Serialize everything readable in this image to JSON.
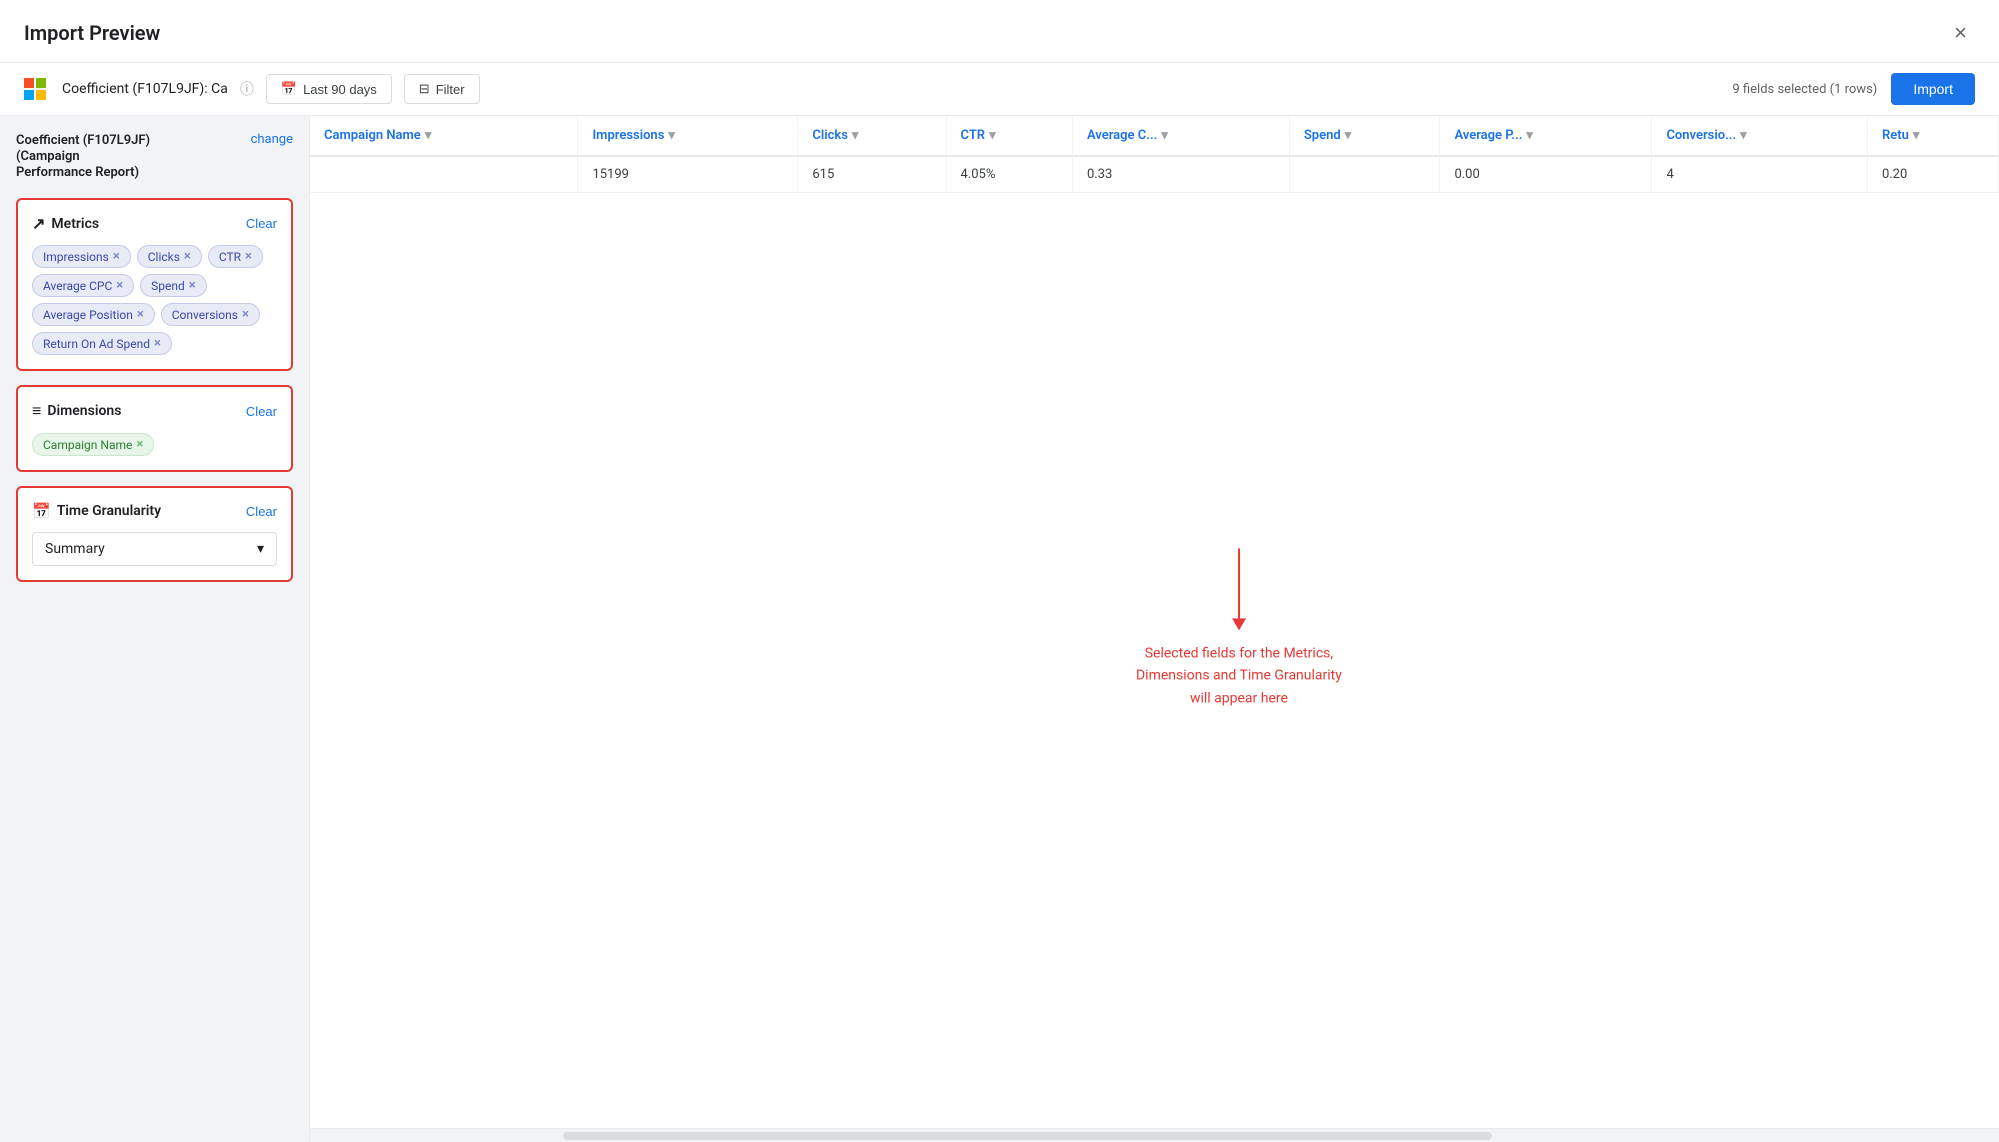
{
  "modal": {
    "title": "Import Preview",
    "close_label": "×"
  },
  "toolbar": {
    "source_name": "Coefficient (F107L9JF): Ca",
    "date_btn_label": "Last 90 days",
    "filter_btn_label": "Filter",
    "fields_info": "9 fields selected (1 rows)",
    "import_label": "Import"
  },
  "sidebar": {
    "source_title_line1": "Coefficient (F107L9JF)",
    "source_title_line2": "(Campaign",
    "source_title_line3": "Performance Report)",
    "change_label": "change",
    "metrics_section": {
      "title": "Metrics",
      "clear_label": "Clear",
      "tags": [
        "Impressions",
        "Clicks",
        "CTR",
        "Average CPC",
        "Spend",
        "Average Position",
        "Conversions",
        "Return On Ad Spend"
      ]
    },
    "dimensions_section": {
      "title": "Dimensions",
      "clear_label": "Clear",
      "tags": [
        "Campaign Name"
      ]
    },
    "time_section": {
      "title": "Time Granularity",
      "clear_label": "Clear",
      "selected": "Summary"
    }
  },
  "table": {
    "columns": [
      {
        "label": "Campaign Name",
        "key": "campaign_name"
      },
      {
        "label": "Impressions",
        "key": "impressions"
      },
      {
        "label": "Clicks",
        "key": "clicks"
      },
      {
        "label": "CTR",
        "key": "ctr"
      },
      {
        "label": "Average C...",
        "key": "avg_c"
      },
      {
        "label": "Spend",
        "key": "spend"
      },
      {
        "label": "Average P...",
        "key": "avg_p"
      },
      {
        "label": "Conversio...",
        "key": "conversions"
      },
      {
        "label": "Retu",
        "key": "retu"
      }
    ],
    "rows": [
      {
        "campaign_name": "",
        "impressions": "15199",
        "clicks": "615",
        "ctr": "4.05%",
        "avg_c": "0.33",
        "spend": "",
        "avg_p": "0.00",
        "conversions": "4",
        "retu": "0.20"
      }
    ]
  },
  "placeholder": {
    "text": "Selected fields for the Metrics,\nDimensions and Time Granularity\nwill appear here"
  },
  "icons": {
    "calendar": "📅",
    "filter": "⊟",
    "trend": "↗",
    "dimensions": "≡",
    "clock": "⏱",
    "sort": "▼"
  },
  "colors": {
    "accent_blue": "#1a73e8",
    "accent_red": "#e53935",
    "border": "#dadce0",
    "bg_light": "#f1f3f4"
  }
}
